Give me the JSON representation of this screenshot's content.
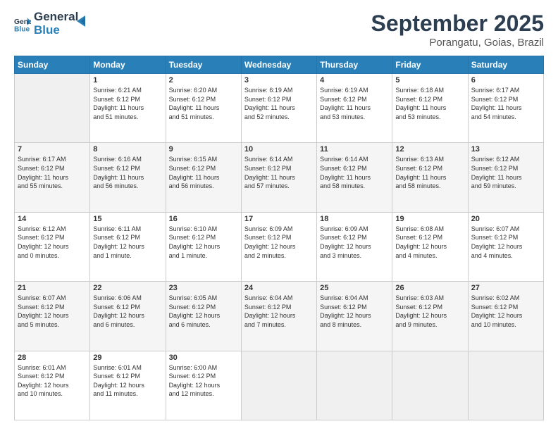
{
  "header": {
    "logo_line1": "General",
    "logo_line2": "Blue",
    "month_title": "September 2025",
    "location": "Porangatu, Goias, Brazil"
  },
  "days_of_week": [
    "Sunday",
    "Monday",
    "Tuesday",
    "Wednesday",
    "Thursday",
    "Friday",
    "Saturday"
  ],
  "weeks": [
    [
      {
        "day": "",
        "info": ""
      },
      {
        "day": "1",
        "info": "Sunrise: 6:21 AM\nSunset: 6:12 PM\nDaylight: 11 hours\nand 51 minutes."
      },
      {
        "day": "2",
        "info": "Sunrise: 6:20 AM\nSunset: 6:12 PM\nDaylight: 11 hours\nand 51 minutes."
      },
      {
        "day": "3",
        "info": "Sunrise: 6:19 AM\nSunset: 6:12 PM\nDaylight: 11 hours\nand 52 minutes."
      },
      {
        "day": "4",
        "info": "Sunrise: 6:19 AM\nSunset: 6:12 PM\nDaylight: 11 hours\nand 53 minutes."
      },
      {
        "day": "5",
        "info": "Sunrise: 6:18 AM\nSunset: 6:12 PM\nDaylight: 11 hours\nand 53 minutes."
      },
      {
        "day": "6",
        "info": "Sunrise: 6:17 AM\nSunset: 6:12 PM\nDaylight: 11 hours\nand 54 minutes."
      }
    ],
    [
      {
        "day": "7",
        "info": "Sunrise: 6:17 AM\nSunset: 6:12 PM\nDaylight: 11 hours\nand 55 minutes."
      },
      {
        "day": "8",
        "info": "Sunrise: 6:16 AM\nSunset: 6:12 PM\nDaylight: 11 hours\nand 56 minutes."
      },
      {
        "day": "9",
        "info": "Sunrise: 6:15 AM\nSunset: 6:12 PM\nDaylight: 11 hours\nand 56 minutes."
      },
      {
        "day": "10",
        "info": "Sunrise: 6:14 AM\nSunset: 6:12 PM\nDaylight: 11 hours\nand 57 minutes."
      },
      {
        "day": "11",
        "info": "Sunrise: 6:14 AM\nSunset: 6:12 PM\nDaylight: 11 hours\nand 58 minutes."
      },
      {
        "day": "12",
        "info": "Sunrise: 6:13 AM\nSunset: 6:12 PM\nDaylight: 11 hours\nand 58 minutes."
      },
      {
        "day": "13",
        "info": "Sunrise: 6:12 AM\nSunset: 6:12 PM\nDaylight: 11 hours\nand 59 minutes."
      }
    ],
    [
      {
        "day": "14",
        "info": "Sunrise: 6:12 AM\nSunset: 6:12 PM\nDaylight: 12 hours\nand 0 minutes."
      },
      {
        "day": "15",
        "info": "Sunrise: 6:11 AM\nSunset: 6:12 PM\nDaylight: 12 hours\nand 1 minute."
      },
      {
        "day": "16",
        "info": "Sunrise: 6:10 AM\nSunset: 6:12 PM\nDaylight: 12 hours\nand 1 minute."
      },
      {
        "day": "17",
        "info": "Sunrise: 6:09 AM\nSunset: 6:12 PM\nDaylight: 12 hours\nand 2 minutes."
      },
      {
        "day": "18",
        "info": "Sunrise: 6:09 AM\nSunset: 6:12 PM\nDaylight: 12 hours\nand 3 minutes."
      },
      {
        "day": "19",
        "info": "Sunrise: 6:08 AM\nSunset: 6:12 PM\nDaylight: 12 hours\nand 4 minutes."
      },
      {
        "day": "20",
        "info": "Sunrise: 6:07 AM\nSunset: 6:12 PM\nDaylight: 12 hours\nand 4 minutes."
      }
    ],
    [
      {
        "day": "21",
        "info": "Sunrise: 6:07 AM\nSunset: 6:12 PM\nDaylight: 12 hours\nand 5 minutes."
      },
      {
        "day": "22",
        "info": "Sunrise: 6:06 AM\nSunset: 6:12 PM\nDaylight: 12 hours\nand 6 minutes."
      },
      {
        "day": "23",
        "info": "Sunrise: 6:05 AM\nSunset: 6:12 PM\nDaylight: 12 hours\nand 6 minutes."
      },
      {
        "day": "24",
        "info": "Sunrise: 6:04 AM\nSunset: 6:12 PM\nDaylight: 12 hours\nand 7 minutes."
      },
      {
        "day": "25",
        "info": "Sunrise: 6:04 AM\nSunset: 6:12 PM\nDaylight: 12 hours\nand 8 minutes."
      },
      {
        "day": "26",
        "info": "Sunrise: 6:03 AM\nSunset: 6:12 PM\nDaylight: 12 hours\nand 9 minutes."
      },
      {
        "day": "27",
        "info": "Sunrise: 6:02 AM\nSunset: 6:12 PM\nDaylight: 12 hours\nand 10 minutes."
      }
    ],
    [
      {
        "day": "28",
        "info": "Sunrise: 6:01 AM\nSunset: 6:12 PM\nDaylight: 12 hours\nand 10 minutes."
      },
      {
        "day": "29",
        "info": "Sunrise: 6:01 AM\nSunset: 6:12 PM\nDaylight: 12 hours\nand 11 minutes."
      },
      {
        "day": "30",
        "info": "Sunrise: 6:00 AM\nSunset: 6:12 PM\nDaylight: 12 hours\nand 12 minutes."
      },
      {
        "day": "",
        "info": ""
      },
      {
        "day": "",
        "info": ""
      },
      {
        "day": "",
        "info": ""
      },
      {
        "day": "",
        "info": ""
      }
    ]
  ]
}
